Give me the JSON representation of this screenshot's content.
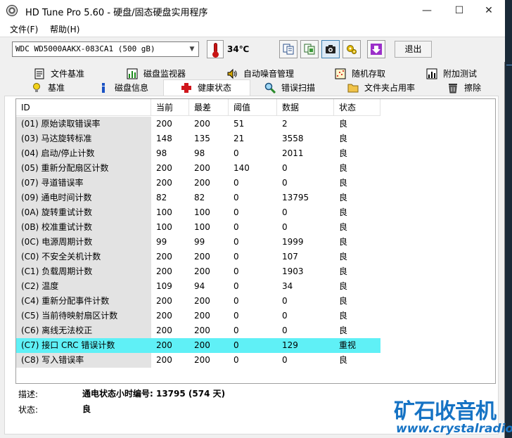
{
  "window": {
    "title": "HD Tune Pro 5.60 - 硬盘/固态硬盘实用程序",
    "minimize": "—",
    "maximize": "☐",
    "close": "✕"
  },
  "menu": [
    "文件(F)",
    "帮助(H)"
  ],
  "toolbar": {
    "drive": "WDC WD5000AAKX-083CA1 (500 gB)",
    "temperature": "34℃",
    "exit_label": "退出"
  },
  "tabs_row1": [
    "文件基准",
    "磁盘监视器",
    "自动噪音管理",
    "随机存取",
    "附加测试"
  ],
  "tabs_row2": [
    "基准",
    "磁盘信息",
    "健康状态",
    "错误扫描",
    "文件夹占用率",
    "擦除"
  ],
  "active_tab": "健康状态",
  "table": {
    "headers": [
      "ID",
      "当前",
      "最差",
      "阈值",
      "数据",
      "状态"
    ],
    "rows": [
      [
        "(01) 原始读取错误率",
        "200",
        "200",
        "51",
        "2",
        "良"
      ],
      [
        "(03) 马达旋转标准",
        "148",
        "135",
        "21",
        "3558",
        "良"
      ],
      [
        "(04) 启动/停止计数",
        "98",
        "98",
        "0",
        "2011",
        "良"
      ],
      [
        "(05) 重新分配扇区计数",
        "200",
        "200",
        "140",
        "0",
        "良"
      ],
      [
        "(07) 寻道错误率",
        "200",
        "200",
        "0",
        "0",
        "良"
      ],
      [
        "(09) 通电时间计数",
        "82",
        "82",
        "0",
        "13795",
        "良"
      ],
      [
        "(0A) 旋转重试计数",
        "100",
        "100",
        "0",
        "0",
        "良"
      ],
      [
        "(0B) 校准重试计数",
        "100",
        "100",
        "0",
        "0",
        "良"
      ],
      [
        "(0C) 电源周期计数",
        "99",
        "99",
        "0",
        "1999",
        "良"
      ],
      [
        "(C0) 不安全关机计数",
        "200",
        "200",
        "0",
        "107",
        "良"
      ],
      [
        "(C1) 负载周期计数",
        "200",
        "200",
        "0",
        "1903",
        "良"
      ],
      [
        "(C2) 温度",
        "109",
        "94",
        "0",
        "34",
        "良"
      ],
      [
        "(C4) 重新分配事件计数",
        "200",
        "200",
        "0",
        "0",
        "良"
      ],
      [
        "(C5) 当前待映射扇区计数",
        "200",
        "200",
        "0",
        "0",
        "良"
      ],
      [
        "(C6) 离线无法校正",
        "200",
        "200",
        "0",
        "0",
        "良"
      ],
      [
        "(C7) 接口 CRC 错误计数",
        "200",
        "200",
        "0",
        "129",
        "重视"
      ],
      [
        "(C8) 写入错误率",
        "200",
        "200",
        "0",
        "0",
        "良"
      ]
    ],
    "highlight_row": 15,
    "highlight_color": "#5ff0f6"
  },
  "details": {
    "desc_label": "描述:",
    "desc_value": "通电状态小时编号: 13795 (574 天)",
    "status_label": "状态:",
    "status_value": "良"
  },
  "watermark": {
    "title": "矿石收音机",
    "url": "www.crystalradio.cn"
  }
}
